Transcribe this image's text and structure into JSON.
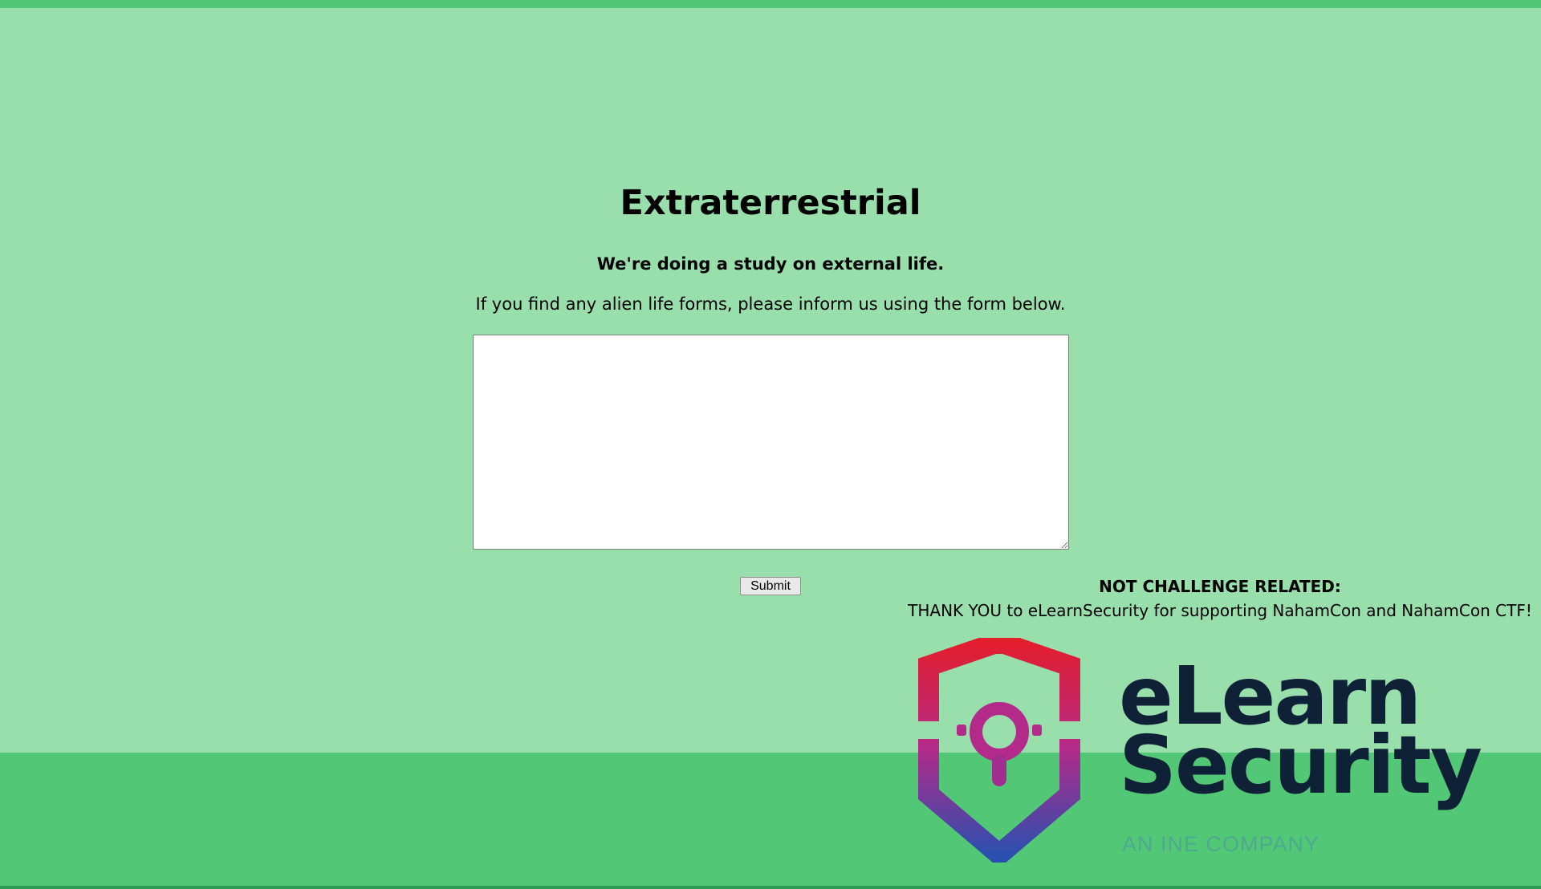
{
  "page": {
    "title": "Extraterrestrial",
    "subtitle": "We're doing a study on external life.",
    "description": "If you find any alien life forms, please inform us using the form below."
  },
  "form": {
    "textarea_value": "",
    "submit_label": "Submit"
  },
  "sponsor": {
    "heading": "NOT CHALLENGE RELATED:",
    "text": "THANK YOU to eLearnSecurity for supporting NahamCon and NahamCon CTF!",
    "logo": {
      "icon": "shield-keyhole-icon",
      "name_line1": "eLearn",
      "name_line2": "Security",
      "tagline": "AN INE COMPANY"
    }
  },
  "colors": {
    "background": "#98dfac",
    "accent_band": "#52c877",
    "brand_dark": "#0f2137",
    "shield_top": "#e31e2d",
    "shield_bottom": "#2b4fae"
  }
}
